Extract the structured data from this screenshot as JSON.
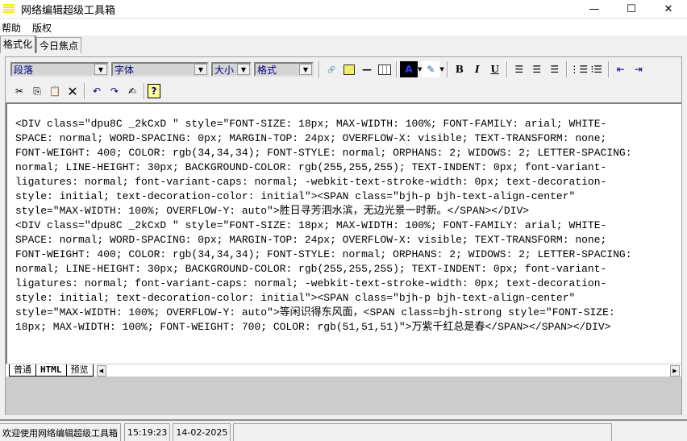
{
  "window": {
    "title": "网络编辑超级工具箱",
    "minimize": "—",
    "maximize": "☐",
    "close": "✕"
  },
  "menu": [
    "帮助",
    "版权"
  ],
  "tabs": [
    "格式化",
    "今日焦点"
  ],
  "toolbar": {
    "paragraph": "段落",
    "font": "字体",
    "size": "大小",
    "format": "格式",
    "bold": "B",
    "italic": "I",
    "underline": "U"
  },
  "editor": {
    "lines": [
      "<DIV class=\"dpu8C _2kCxD \" style=\"FONT-SIZE: 18px; MAX-WIDTH: 100%; FONT-FAMILY: arial; WHITE-",
      "SPACE: normal; WORD-SPACING: 0px; MARGIN-TOP: 24px; OVERFLOW-X: visible; TEXT-TRANSFORM: none;",
      "FONT-WEIGHT: 400; COLOR: rgb(34,34,34); FONT-STYLE: normal; ORPHANS: 2; WIDOWS: 2; LETTER-SPACING:",
      "normal; LINE-HEIGHT: 30px; BACKGROUND-COLOR: rgb(255,255,255); TEXT-INDENT: 0px; font-variant-",
      "ligatures: normal; font-variant-caps: normal; -webkit-text-stroke-width: 0px; text-decoration-",
      "style: initial; text-decoration-color: initial\"><SPAN class=\"bjh-p bjh-text-align-center\"",
      "style=\"MAX-WIDTH: 100%; OVERFLOW-Y: auto\">胜日寻芳泗水滨，无边光景一时新。</SPAN></DIV>",
      "<DIV class=\"dpu8C _2kCxD \" style=\"FONT-SIZE: 18px; MAX-WIDTH: 100%; FONT-FAMILY: arial; WHITE-",
      "SPACE: normal; WORD-SPACING: 0px; MARGIN-TOP: 24px; OVERFLOW-X: visible; TEXT-TRANSFORM: none;",
      "FONT-WEIGHT: 400; COLOR: rgb(34,34,34); FONT-STYLE: normal; ORPHANS: 2; WIDOWS: 2; LETTER-SPACING:",
      "normal; LINE-HEIGHT: 30px; BACKGROUND-COLOR: rgb(255,255,255); TEXT-INDENT: 0px; font-variant-",
      "ligatures: normal; font-variant-caps: normal; -webkit-text-stroke-width: 0px; text-decoration-",
      "style: initial; text-decoration-color: initial\"><SPAN class=\"bjh-p bjh-text-align-center\"",
      "style=\"MAX-WIDTH: 100%; OVERFLOW-Y: auto\">等闲识得东风面，<SPAN class=bjh-strong style=\"FONT-SIZE:",
      "18px; MAX-WIDTH: 100%; FONT-WEIGHT: 700; COLOR: rgb(51,51,51)\">万紫千红总是春</SPAN></SPAN></DIV>"
    ]
  },
  "view_tabs": [
    "普通",
    "HTML",
    "预览"
  ],
  "status": {
    "message": "欢迎使用网络编辑超级工具箱",
    "time": "15:19:23",
    "date": "14-02-2025"
  }
}
